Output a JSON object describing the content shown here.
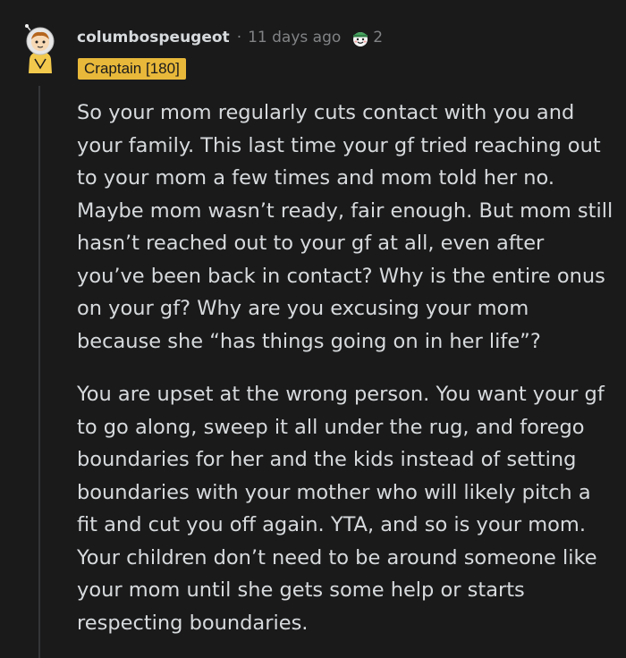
{
  "comment": {
    "username": "columbospeugeot",
    "separator": "·",
    "timestamp": "11 days ago",
    "award": {
      "icon": "wholesome-award-icon",
      "count": "2"
    },
    "flair": "Craptain [180]",
    "paragraphs": [
      "So your mom regularly cuts contact with you and your family. This last time your gf tried reaching out to your mom a few times and mom told her no. Maybe mom wasn’t ready, fair enough. But mom still hasn’t reached out to your gf at all, even after you’ve been back in contact? Why is the entire onus on your gf? Why are you excusing your mom because she “has things going on in her life”?",
      "You are upset at the wrong person. You want your gf to go along, sweep it all under the rug, and forego boundaries for her and the kids instead of setting boundaries with your mother who will likely pitch a fit and cut you off again. YTA, and so is your mom. Your children don’t need to be around someone like your mom until she gets some help or starts respecting boundaries."
    ]
  },
  "colors": {
    "background": "#1a1a1b",
    "text": "#d7dadc",
    "meta": "#818384",
    "flair_bg": "#e8b83a",
    "thread_line": "#343536"
  }
}
